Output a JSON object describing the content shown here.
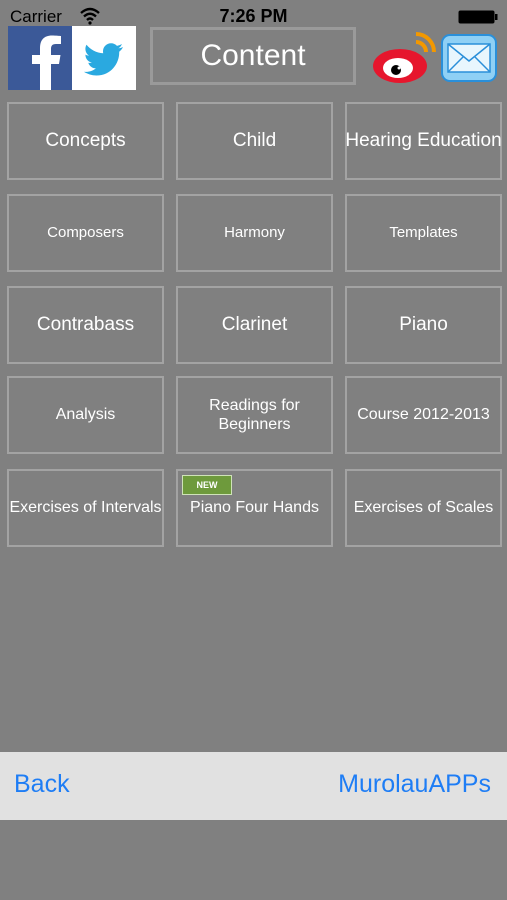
{
  "status_bar": {
    "carrier": "Carrier",
    "time": "7:26 PM",
    "wifi_icon": "wifi-icon",
    "battery_icon": "battery-icon"
  },
  "header": {
    "title": "Content",
    "share_icons": [
      "facebook-icon",
      "twitter-icon",
      "weibo-icon",
      "mail-icon"
    ]
  },
  "grid": {
    "rows": [
      [
        "Concepts",
        "Child",
        "Hearing Education"
      ],
      [
        "Composers",
        "Harmony",
        "Templates"
      ],
      [
        "Contrabass",
        "Clarinet",
        "Piano"
      ],
      [
        "Analysis",
        "Readings for Beginners",
        "Course 2012-2013"
      ],
      [
        "Exercises of Intervals",
        "Piano Four Hands",
        "Exercises of Scales"
      ]
    ],
    "new_badge": "NEW"
  },
  "bottom_bar": {
    "back": "Back",
    "brand": "MurolauAPPs"
  },
  "colors": {
    "background": "#808080",
    "tile_border": "#a3a3a3",
    "link": "#1e7df5",
    "bottom_bar": "#e1e1e1",
    "new_badge": "#6e9a3c"
  }
}
